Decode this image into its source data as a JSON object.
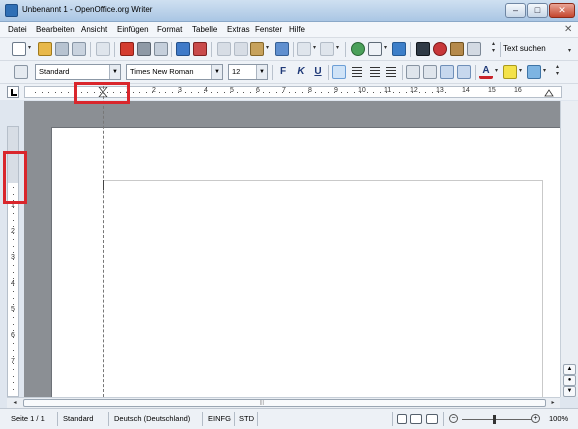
{
  "window": {
    "title": "Unbenannt 1 - OpenOffice.org Writer",
    "min": "–",
    "max": "□",
    "close": "✕"
  },
  "menu": [
    "Datei",
    "Bearbeiten",
    "Ansicht",
    "Einfügen",
    "Format",
    "Tabelle",
    "Extras",
    "Fenster",
    "Hilfe"
  ],
  "menu_close": "✕",
  "toolbar": {
    "find_label": "Text suchen",
    "style": "Standard",
    "font": "Times New Roman",
    "size": "12",
    "bold": "F",
    "italic": "K",
    "underline": "U"
  },
  "ruler": {
    "h_numbers": [
      "1",
      "2",
      "3",
      "4",
      "5",
      "6",
      "7",
      "8",
      "9",
      "10",
      "11",
      "12",
      "13",
      "14",
      "15",
      "16"
    ],
    "v_numbers": [
      "1",
      "2",
      "3",
      "4",
      "5",
      "6",
      "7"
    ]
  },
  "status": {
    "page": "Seite 1 / 1",
    "style": "Standard",
    "language": "Deutsch (Deutschland)",
    "insert_mode": "EINFG",
    "selection_mode": "STD",
    "zoom": "100%"
  },
  "colors": {
    "highlight": "#d9262c",
    "workspace": "#8b8f94"
  }
}
